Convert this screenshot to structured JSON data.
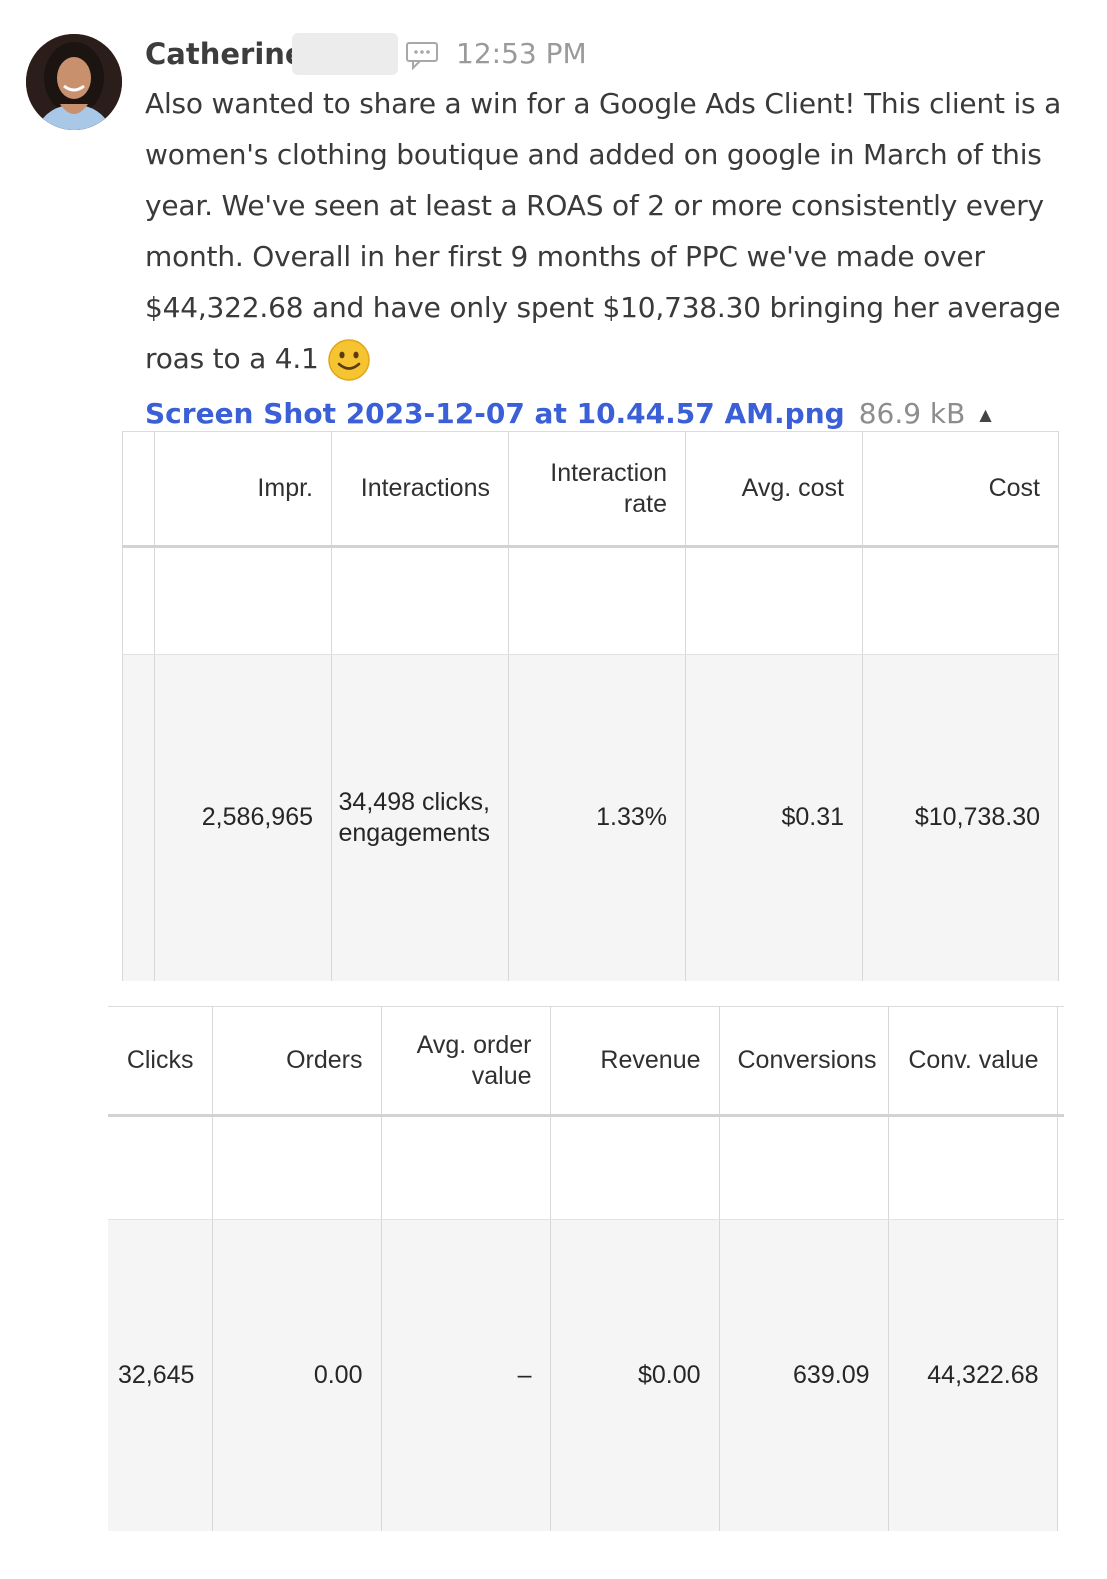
{
  "message": {
    "author": "Catherine",
    "time": "12:53 PM",
    "lines": [
      "Also wanted to share a win for a Google Ads Client! This client is a",
      "women's clothing boutique and added on google in March of this",
      "year. We've seen at least a ROAS of 2 or more consistently every",
      "month. Overall in her first 9 months of PPC we've made over",
      "$44,322.68 and have only spent $10,738.30 bringing her average",
      "roas to a 4.1"
    ],
    "emoji": "smiley-face-icon",
    "attachment": {
      "filename": "Screen Shot 2023-12-07 at 10.44.57 AM.png",
      "size": "86.9 kB",
      "caret": "▲"
    }
  },
  "table1": {
    "headers": [
      "",
      "Impr.",
      "Interactions",
      "Interaction rate",
      "Avg. cost",
      "Cost"
    ],
    "row": [
      "",
      "2,586,965",
      "34,498 clicks, engagements",
      "1.33%",
      "$0.31",
      "$10,738.30"
    ]
  },
  "table2": {
    "headers": [
      "Clicks",
      "Orders",
      "Avg. order value",
      "Revenue",
      "Conversions",
      "Conv. value"
    ],
    "row": [
      "32,645",
      "0.00",
      "–",
      "$0.00",
      "639.09",
      "44,322.68"
    ]
  },
  "colors": {
    "link": "#3b5fd6",
    "emoji": "#f6c431",
    "row_bg": "#f5f5f5"
  }
}
